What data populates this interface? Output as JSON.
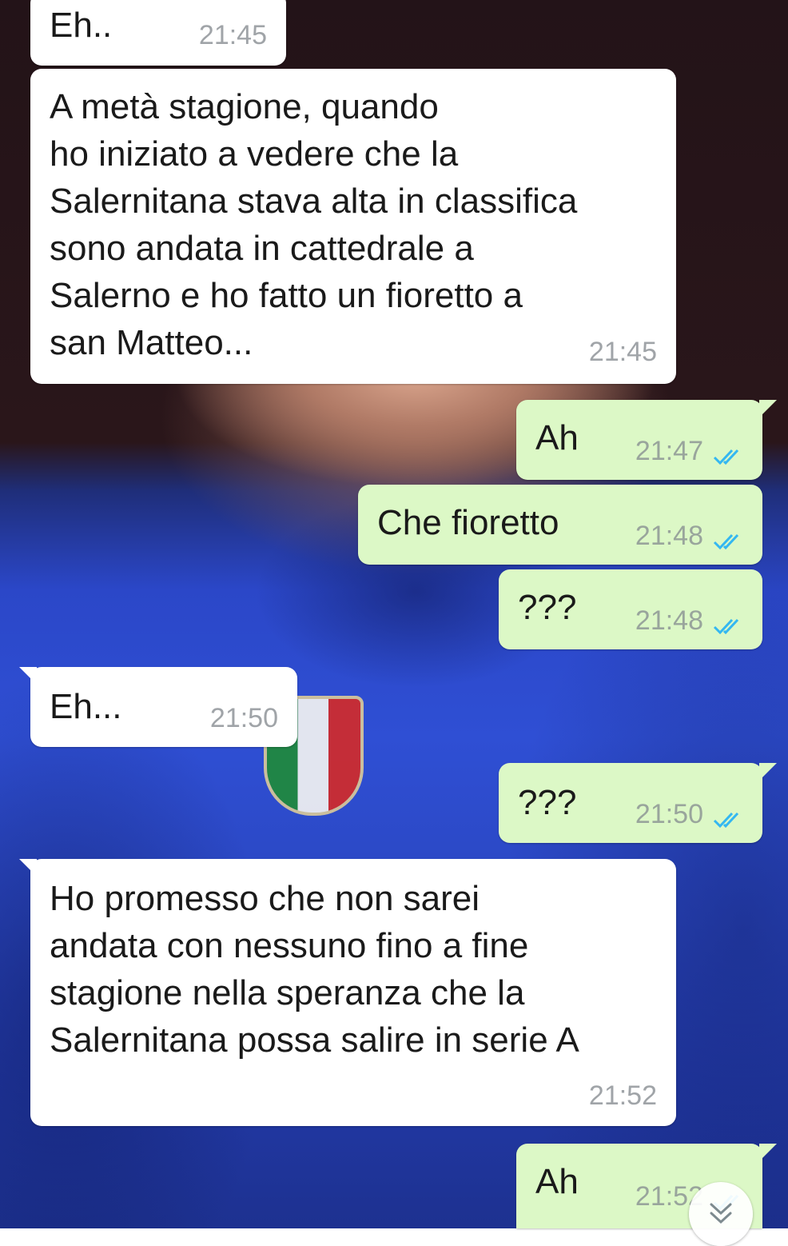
{
  "conversation": {
    "messages": [
      {
        "id": "m1",
        "direction": "incoming",
        "text": "Eh..",
        "time": "21:45"
      },
      {
        "id": "m2",
        "direction": "incoming",
        "text": "A metà stagione, quando\nho iniziato a vedere che la\nSalernitana stava alta in classifica\nsono andata in cattedrale a\nSalerno e ho fatto un fioretto a\nsan Matteo...",
        "time": "21:45"
      },
      {
        "id": "m3",
        "direction": "outgoing",
        "text": "Ah",
        "time": "21:47",
        "status": "read"
      },
      {
        "id": "m4",
        "direction": "outgoing",
        "text": "Che fioretto",
        "time": "21:48",
        "status": "read"
      },
      {
        "id": "m5",
        "direction": "outgoing",
        "text": "???",
        "time": "21:48",
        "status": "read"
      },
      {
        "id": "m6",
        "direction": "incoming",
        "text": "Eh...",
        "time": "21:50"
      },
      {
        "id": "m7",
        "direction": "outgoing",
        "text": "???",
        "time": "21:50",
        "status": "read"
      },
      {
        "id": "m8",
        "direction": "incoming",
        "text": "Ho promesso che non sarei\nandata con nessuno fino a fine\nstagione nella speranza che la\nSalernitana possa salire in serie A",
        "time": "21:52"
      },
      {
        "id": "m9",
        "direction": "outgoing",
        "text": "Ah",
        "time": "21:52",
        "status": "read"
      }
    ],
    "scroll_down_icon": "double-chevron-down-icon"
  },
  "colors": {
    "incoming_bubble": "#ffffff",
    "outgoing_bubble": "#dcf8c6",
    "read_ticks": "#34b7f1",
    "timestamp": "#a0a4a8"
  }
}
